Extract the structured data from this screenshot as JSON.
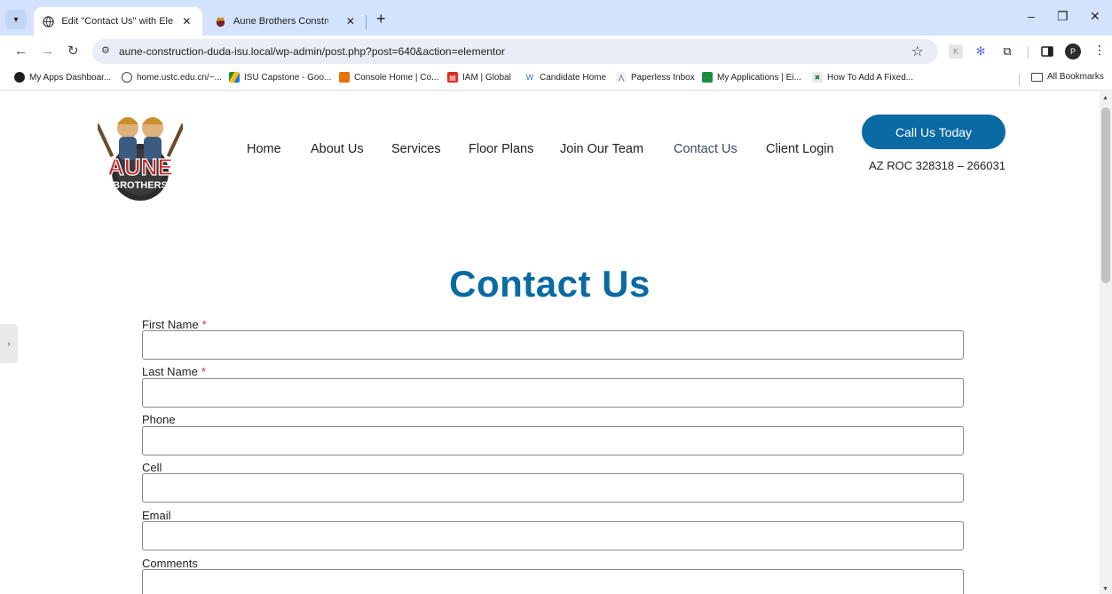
{
  "browser": {
    "tabs": [
      {
        "title": "Edit \"Contact Us\" with Elementor",
        "close": "✕"
      },
      {
        "title": "Aune Brothers Construction",
        "close": "✕"
      }
    ],
    "new_tab": "+",
    "url": "aune-construction-duda-isu.local/wp-admin/post.php?post=640&action=elementor",
    "profile_initial": "P",
    "bookmarks": [
      "My Apps Dashboar...",
      "home.ustc.edu.cn/~...",
      "ISU Capstone - Goo...",
      "Console Home | Co...",
      "IAM | Global",
      "Candidate Home",
      "Paperless Inbox",
      "My Applications | Ei...",
      "How To Add A Fixed..."
    ],
    "all_bookmarks": "All Bookmarks"
  },
  "site": {
    "logo_text": [
      "AUNE",
      "BROTHERS"
    ],
    "nav": [
      "Home",
      "About Us",
      "Services",
      "Floor Plans",
      "Join Our Team",
      "Contact Us",
      "Client Login"
    ],
    "current_nav": "Contact Us",
    "cta": "Call Us Today",
    "license": "AZ ROC 328318 – 266031",
    "page_title": "Contact Us",
    "form": {
      "fields": [
        {
          "label": "First Name",
          "required": true
        },
        {
          "label": "Last Name",
          "required": true
        },
        {
          "label": "Phone",
          "required": false
        },
        {
          "label": "Cell",
          "required": false
        },
        {
          "label": "Email",
          "required": false
        },
        {
          "label": "Comments",
          "required": false
        }
      ],
      "required_marker": "*"
    }
  },
  "colors": {
    "brand_blue": "#0a6aa3",
    "tabstrip": "#d3e3fd",
    "required_red": "#d32f2f"
  }
}
